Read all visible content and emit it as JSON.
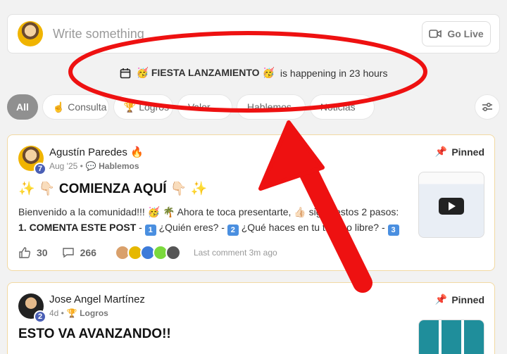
{
  "composer": {
    "placeholder": "Write something",
    "golive_label": "Go Live"
  },
  "event": {
    "name": "🥳 FIESTA LANZAMIENTO 🥳",
    "suffix": "is happening in 23 hours"
  },
  "chips": [
    {
      "label": "All"
    },
    {
      "label": "☝️ Consulta"
    },
    {
      "label": "🏆 Logros"
    },
    {
      "label": "Valor"
    },
    {
      "label": "Hablemos"
    },
    {
      "label": "Noticias"
    }
  ],
  "posts": [
    {
      "author": "Agustín Paredes 🔥",
      "level": "7",
      "date": "Aug '25 •",
      "category": "💬 Hablemos",
      "pinned": "Pinned",
      "title": "✨ 👇🏻 COMIENZA AQUÍ 👇🏻 ✨",
      "line1": "Bienvenido a la comunidad!!! 🥳 🌴 Ahora te toca presentarte, 👍🏻 sigue estos 2 pasos:",
      "line2_bold": "1. COMENTA ESTE POST",
      "line2_a": "- ",
      "line2_b": " ¿Quién eres? - ",
      "line2_c": " ¿Qué haces en tu tiempo libre? - ",
      "likes": "30",
      "comments": "266",
      "last_comment": "Last comment 3m ago"
    },
    {
      "author": "Jose Angel Martínez",
      "level": "2",
      "date": "4d •",
      "category": "🏆 Logros",
      "pinned": "Pinned",
      "title": "ESTO VA AVANZANDO!!"
    }
  ],
  "colors": {
    "accent": "#4a5fb5",
    "annotation": "#ee1111"
  }
}
